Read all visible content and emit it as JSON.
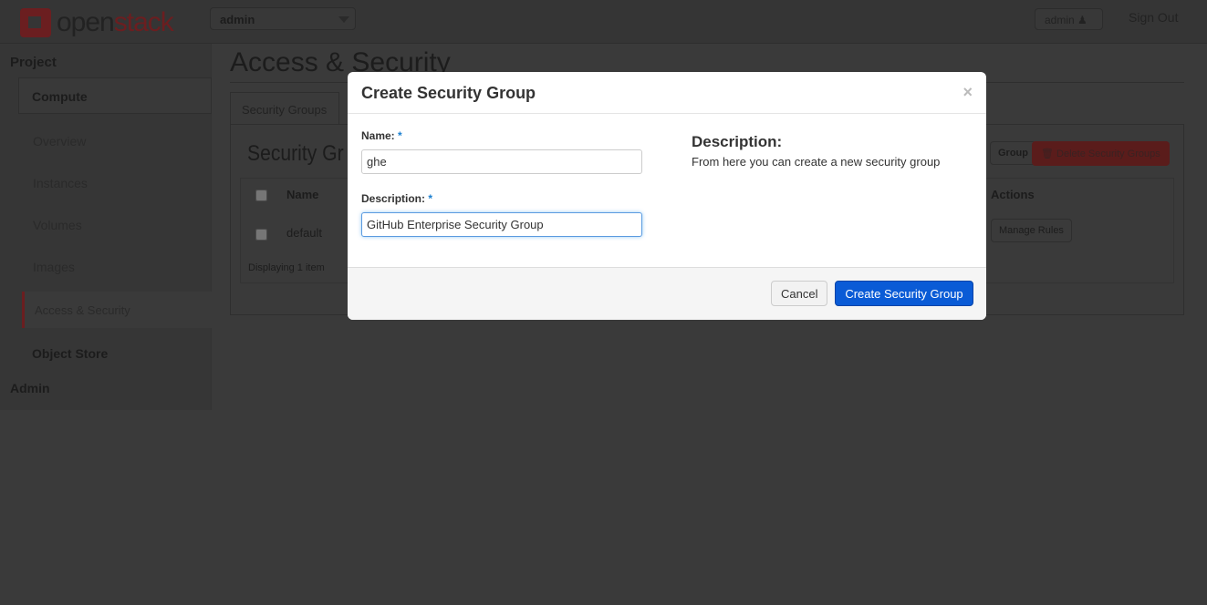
{
  "header": {
    "logo": "openstack",
    "project_select": "admin",
    "user_menu": "admin",
    "sign_out": "Sign Out"
  },
  "sidebar": {
    "project": "Project",
    "compute": "Compute",
    "items": [
      "Overview",
      "Instances",
      "Volumes",
      "Images",
      "Access & Security"
    ],
    "object_store": "Object Store",
    "admin": "Admin"
  },
  "main": {
    "title": "Access & Security",
    "tab": "Security Groups",
    "section_title": "Security Gr",
    "create_button": "Group",
    "delete_button": "Delete Security Groups",
    "columns": [
      "Name",
      "Actions"
    ],
    "rows": [
      {
        "name": "default",
        "action": "Manage Rules"
      }
    ],
    "footer": "Displaying 1 item"
  },
  "modal": {
    "title": "Create Security Group",
    "close": "×",
    "name_label": "Name:",
    "required": "*",
    "name_value": "ghe",
    "description_label": "Description:",
    "description_value": "GitHub Enterprise Security Group",
    "help_title": "Description:",
    "help_text": "From here you can create a new security group",
    "cancel": "Cancel",
    "submit": "Create Security Group"
  },
  "colors": {
    "primary": "#0a5bd6",
    "danger": "#b0262a",
    "required": "#1a7fcf"
  }
}
